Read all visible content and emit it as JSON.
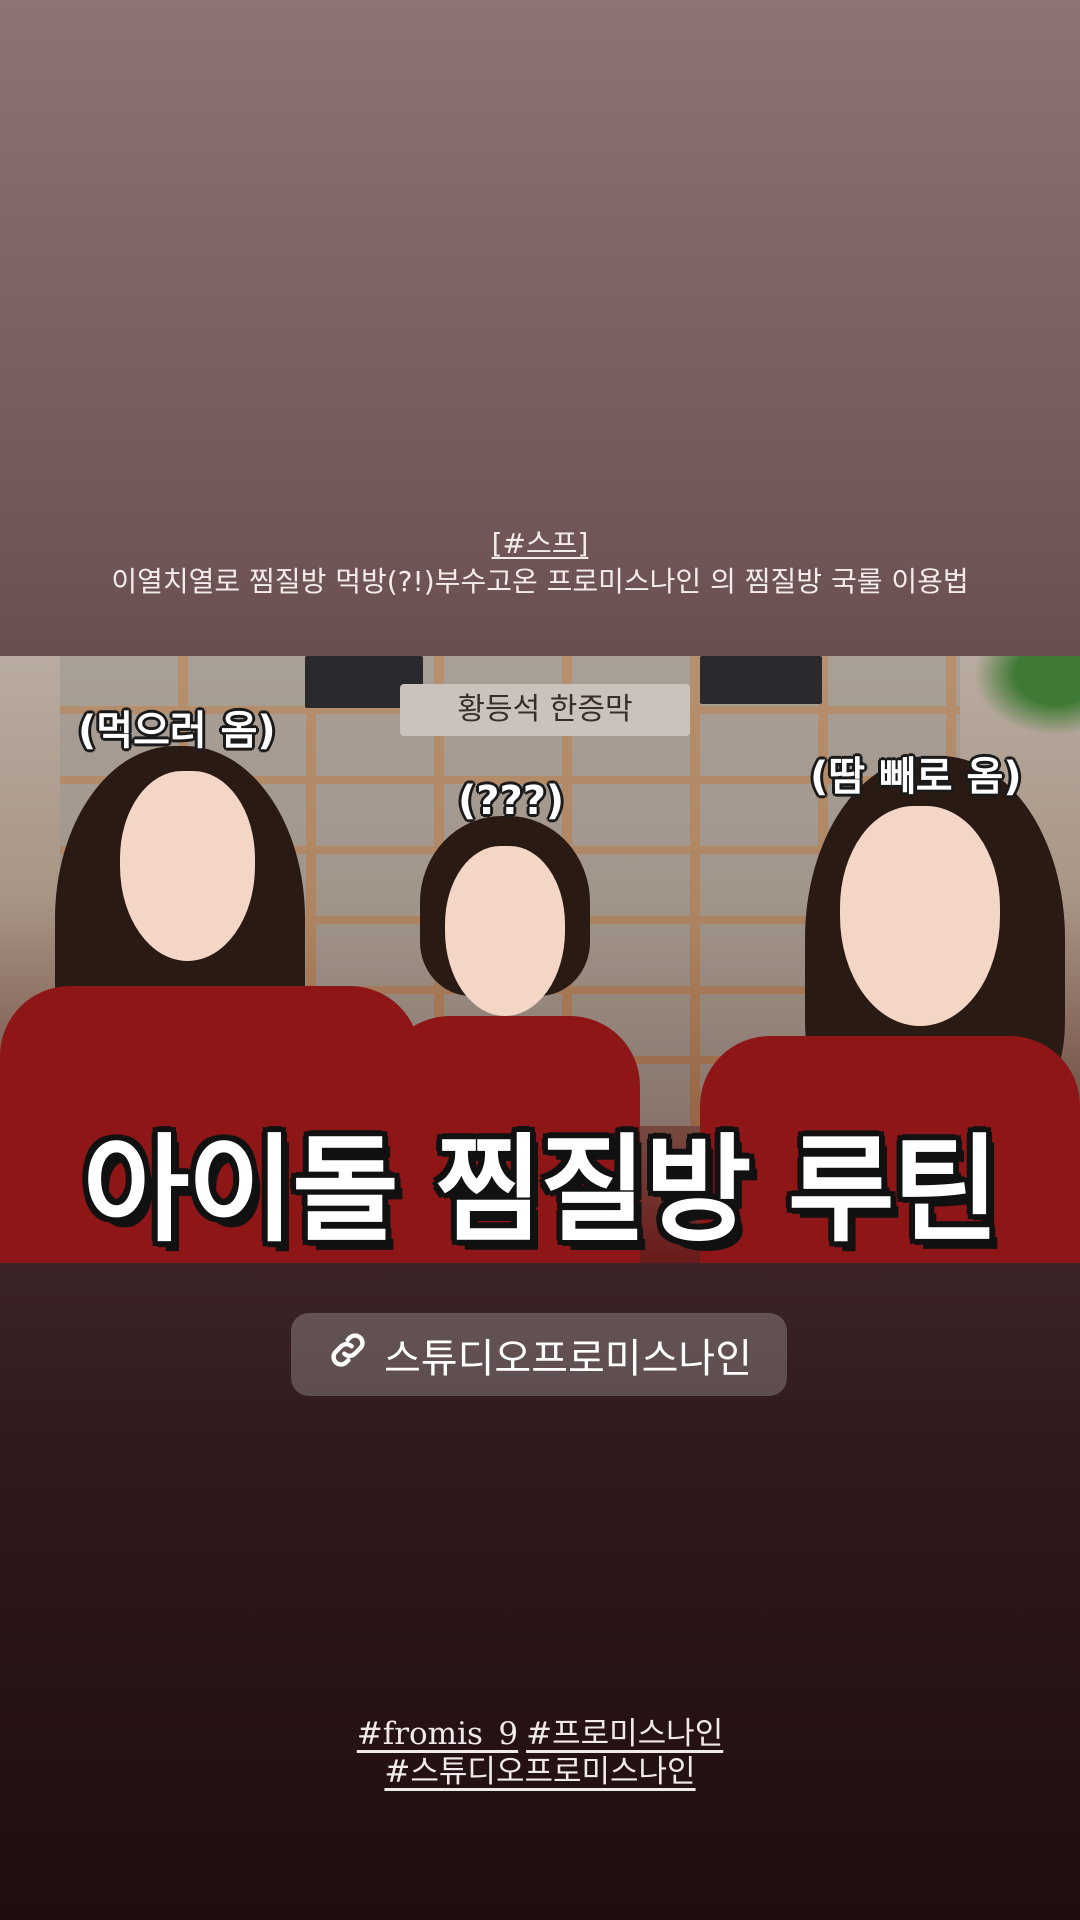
{
  "story": {
    "caption_tag": "[#스프]",
    "caption_text": "이열치열로 찜질방 먹방(?!)부수고온 프로미스나인 의 찜질방 국룰 이용법"
  },
  "thumbnail": {
    "sign_text": "황등석 한증막",
    "bubble_left": "(먹으러 옴)",
    "bubble_middle": "(???)",
    "bubble_right": "(땀 빼로 옴)",
    "title": "아이돌 찜질방 루틴"
  },
  "link_sticker": {
    "icon": "link-icon",
    "label": "스튜디오프로미스나인"
  },
  "hashtags": [
    "#fromis_9",
    "#프로미스나인",
    "#스튜디오프로미스나인"
  ]
}
